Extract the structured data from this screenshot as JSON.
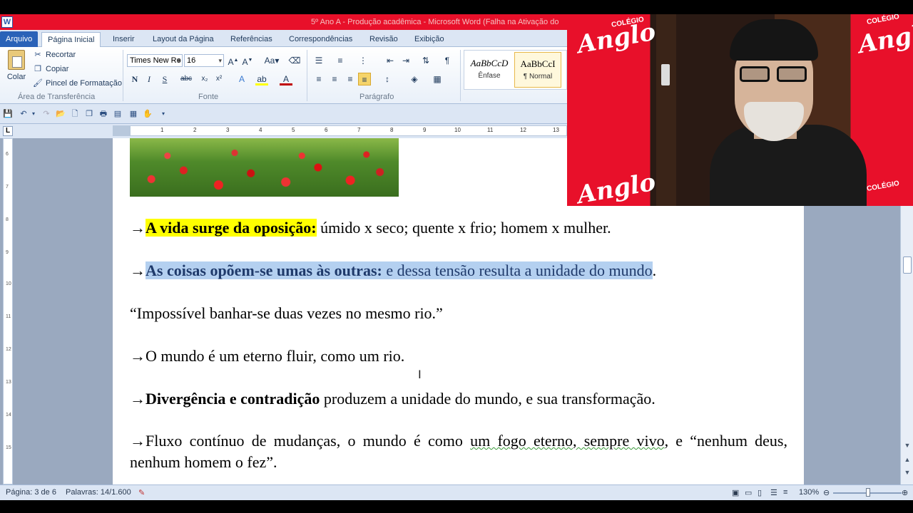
{
  "window": {
    "title": "5º Ano A - Produção acadêmica - Microsoft Word (Falha na Ativação do"
  },
  "tabs": [
    "Arquivo",
    "Página Inicial",
    "Inserir",
    "Layout da Página",
    "Referências",
    "Correspondências",
    "Revisão",
    "Exibição"
  ],
  "ribbon": {
    "clipboard": {
      "paste": "Colar",
      "cut": "Recortar",
      "copy": "Copiar",
      "format_painter": "Pincel de Formatação",
      "label": "Área de Transferência"
    },
    "font": {
      "name": "Times New Ro",
      "size": "16",
      "label": "Fonte"
    },
    "paragraph": {
      "label": "Parágrafo"
    },
    "styles": [
      {
        "sample": "AaBbCcD",
        "name": "Ênfase"
      },
      {
        "sample": "AaBbCcI",
        "name": "¶ Normal"
      }
    ]
  },
  "document": {
    "p1": {
      "arrow": "→",
      "bold": "A vida surge da oposição:",
      "rest": " úmido x seco; quente x frio; homem x mulher."
    },
    "p2": {
      "arrow": "→",
      "bold": "As coisas opõem-se umas às outras:",
      "rest": " e dessa tensão resulta a unidade do mundo",
      "tail": "."
    },
    "p3": {
      "text": "“Impossível banhar-se duas vezes no mesmo rio.”"
    },
    "p4": {
      "arrow": "→",
      "text": "O mundo é um eterno fluir, como um rio."
    },
    "p5": {
      "arrow": "→",
      "bold": "Divergência e contradição",
      "rest": " produzem a unidade do mundo, e sua transformação."
    },
    "p6": {
      "arrow": "→",
      "text_a": "Fluxo contínuo de mudanças, o mundo é como ",
      "underlined": "um fogo eterno, sempre vivo",
      "text_b": ", e “nenhum deus, nenhum homem o fez”."
    }
  },
  "status": {
    "page": "Página: 3 de 6",
    "words": "Palavras: 14/1.600",
    "zoom": "130%"
  },
  "video": {
    "logo": "Anglo",
    "logo_small": "COLÉGIO"
  }
}
